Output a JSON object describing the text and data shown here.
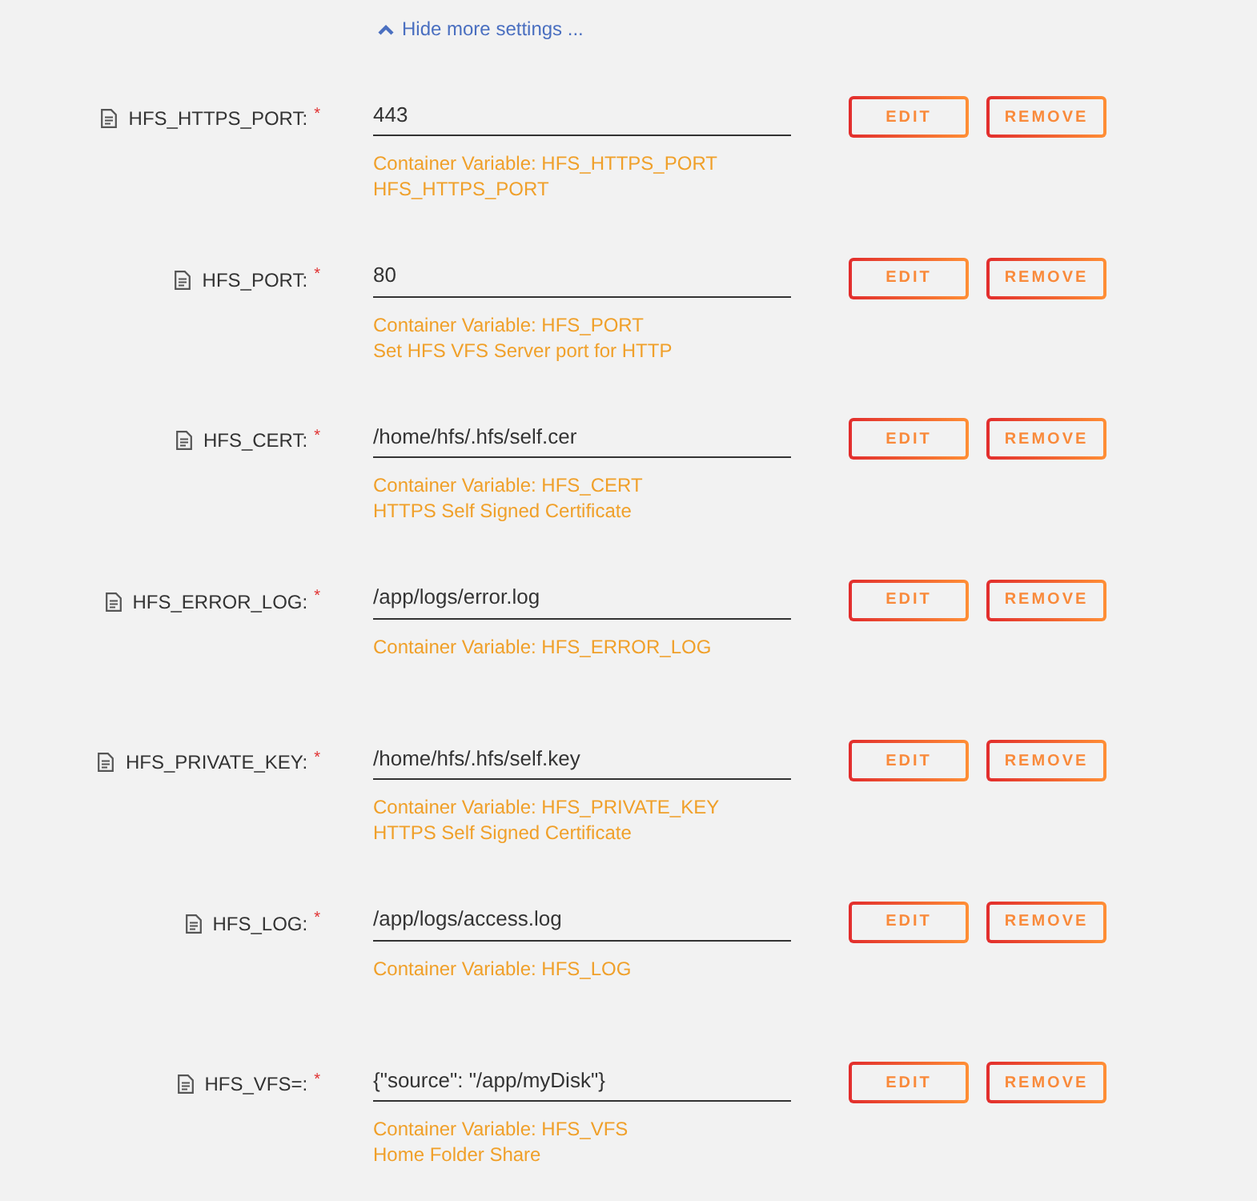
{
  "toggle": {
    "label": "Hide more settings ...",
    "expanded": true
  },
  "variables": [
    {
      "label": "HFS_HTTPS_PORT:",
      "mark": "*",
      "value": "443",
      "description": [
        "Container Variable: HFS_HTTPS_PORT",
        "HFS_HTTPS_PORT"
      ],
      "buttons": [
        "EDIT",
        "REMOVE"
      ]
    },
    {
      "label": "HFS_PORT:",
      "mark": "*",
      "value": "80",
      "description": [
        "Container Variable: HFS_PORT",
        "Set HFS VFS Server port for HTTP"
      ],
      "buttons": [
        "EDIT",
        "REMOVE"
      ]
    },
    {
      "label": "HFS_CERT:",
      "mark": "*",
      "value": "/home/hfs/.hfs/self.cer",
      "description": [
        "Container Variable: HFS_CERT",
        "HTTPS Self Signed Certificate"
      ],
      "buttons": [
        "EDIT",
        "REMOVE"
      ]
    },
    {
      "label": "HFS_ERROR_LOG:",
      "mark": "*",
      "value": "/app/logs/error.log",
      "description": [
        "Container Variable: HFS_ERROR_LOG"
      ],
      "buttons": [
        "EDIT",
        "REMOVE"
      ]
    },
    {
      "label": "HFS_PRIVATE_KEY:",
      "mark": "*",
      "value": "/home/hfs/.hfs/self.key",
      "description": [
        "Container Variable: HFS_PRIVATE_KEY",
        "HTTPS Self Signed Certificate"
      ],
      "buttons": [
        "EDIT",
        "REMOVE"
      ]
    },
    {
      "label": "HFS_LOG:",
      "mark": "*",
      "value": "/app/logs/access.log",
      "description": [
        "Container Variable: HFS_LOG"
      ],
      "buttons": [
        "EDIT",
        "REMOVE"
      ]
    },
    {
      "label": "HFS_VFS=:",
      "mark": "*",
      "value": "{\"source\": \"/app/myDisk\"}",
      "description": [
        "Container Variable: HFS_VFS",
        "Home Folder Share"
      ],
      "buttons": [
        "EDIT",
        "REMOVE"
      ]
    }
  ]
}
